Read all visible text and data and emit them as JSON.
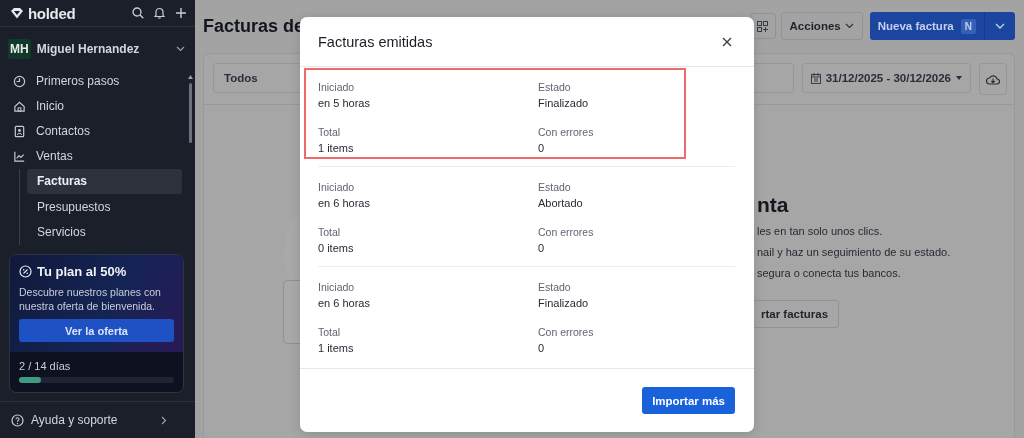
{
  "sidebar": {
    "brand": "holded",
    "user": {
      "initials": "MH",
      "name": "Miguel Hernandez"
    },
    "nav": [
      {
        "label": "Primeros pasos",
        "selected": false
      },
      {
        "label": "Inicio",
        "selected": false
      },
      {
        "label": "Contactos",
        "selected": false
      },
      {
        "label": "Ventas",
        "selected": false,
        "children": [
          {
            "label": "Facturas",
            "selected": true
          },
          {
            "label": "Presupuestos",
            "selected": false
          },
          {
            "label": "Servicios",
            "selected": false
          }
        ]
      }
    ],
    "plan": {
      "title": "Tu plan al 50%",
      "text": "Descubre nuestros planes con nuestra oferta de bienvenida.",
      "button": "Ver la oferta",
      "days": "2 / 14 días",
      "level": 0.14
    },
    "help": "Ayuda y soporte"
  },
  "main": {
    "title": "Facturas de",
    "actions": "Acciones",
    "new_button": {
      "label": "Nueva factura",
      "shortcut": "N"
    },
    "filter": "Todos",
    "date_range": "31/12/2025 - 30/12/2026",
    "empty_state": {
      "heading": "nta",
      "lines": [
        "les en tan solo unos clics.",
        "nail y haz un seguimiento de su estado.",
        "segura o conecta tus bancos."
      ],
      "button": "rtar facturas"
    }
  },
  "modal": {
    "title": "Facturas emitidas",
    "entries": [
      {
        "highlighted": true,
        "fields": [
          {
            "label": "Iniciado",
            "value": "en 5 horas"
          },
          {
            "label": "Estado",
            "value": "Finalizado"
          },
          {
            "label": "Total",
            "value": "1 items"
          },
          {
            "label": "Con errores",
            "value": "0"
          }
        ]
      },
      {
        "highlighted": false,
        "fields": [
          {
            "label": "Iniciado",
            "value": "en 6 horas"
          },
          {
            "label": "Estado",
            "value": "Abortado"
          },
          {
            "label": "Total",
            "value": "0 items"
          },
          {
            "label": "Con errores",
            "value": "0"
          }
        ]
      },
      {
        "highlighted": false,
        "fields": [
          {
            "label": "Iniciado",
            "value": "en 6 horas"
          },
          {
            "label": "Estado",
            "value": "Finalizado"
          },
          {
            "label": "Total",
            "value": "1 items"
          },
          {
            "label": "Con errores",
            "value": "0"
          }
        ]
      }
    ],
    "button": "Importar más"
  }
}
